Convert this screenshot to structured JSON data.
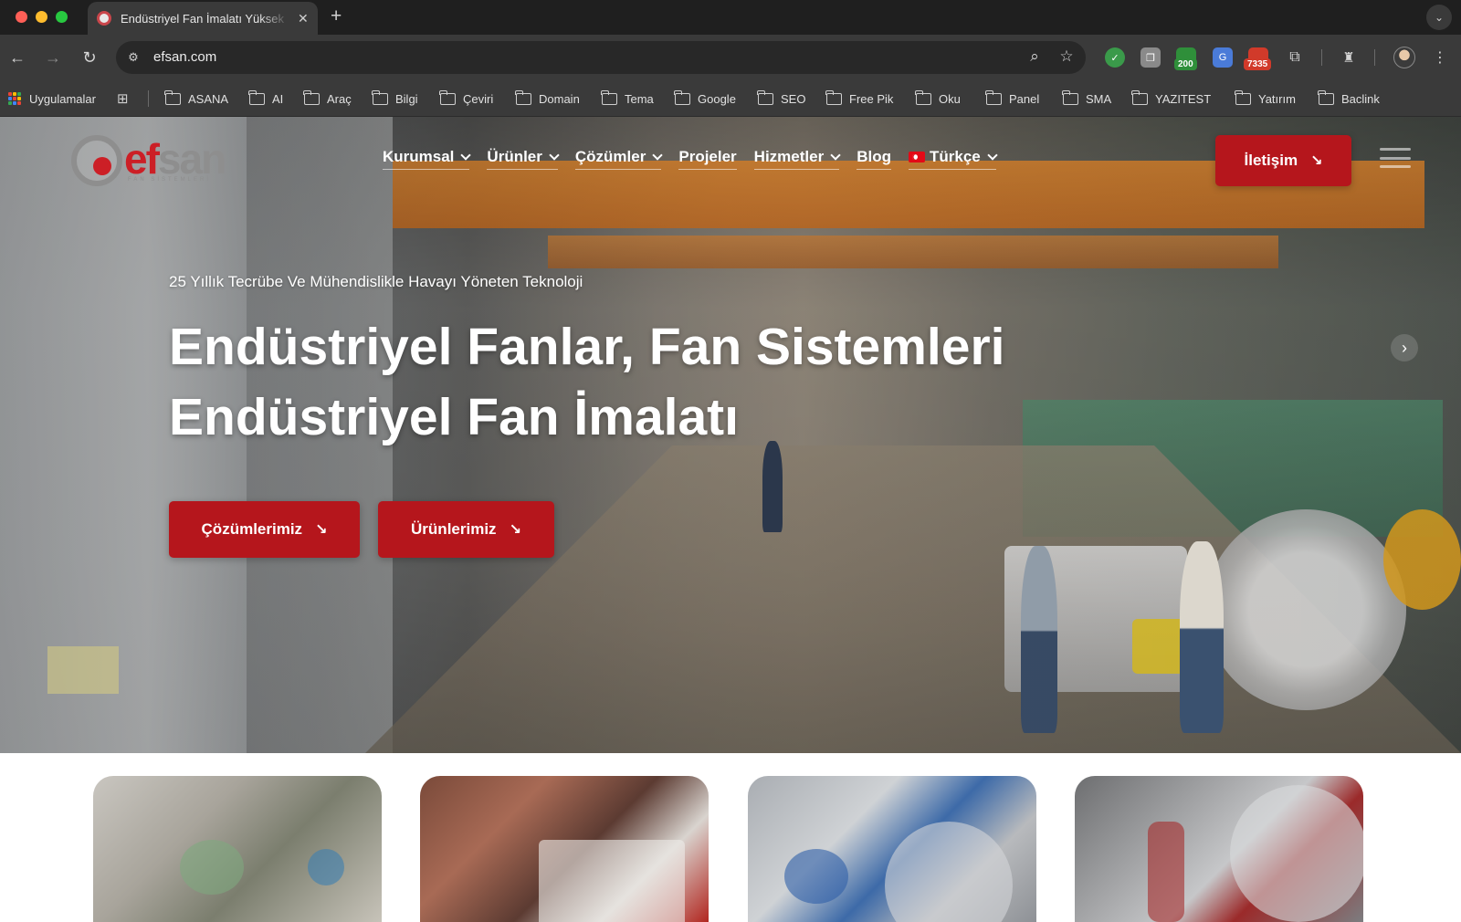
{
  "browser": {
    "tab_title": "Endüstriyel Fan İmalatı Yüksek",
    "url": "efsan.com",
    "extensions": [
      {
        "name": "shield-extension-icon",
        "color": "#3a9a4a"
      },
      {
        "name": "copy-extension-icon",
        "color": "#8a8a8a"
      },
      {
        "name": "badge-200-extension-icon",
        "color": "#2f8f3a",
        "badge": "200"
      },
      {
        "name": "translate-extension-icon",
        "color": "#4a7bd8"
      },
      {
        "name": "badge-7335-extension-icon",
        "color": "#d13a2a",
        "badge": "7335"
      }
    ]
  },
  "bookmarks": {
    "apps_label": "Uygulamalar",
    "folders": [
      "ASANA",
      "AI",
      "Araç",
      "Bilgi",
      "Çeviri",
      "Domain",
      "Tema",
      "Google",
      "SEO",
      "Free Pik",
      "Oku",
      "Panel",
      "SMA",
      "YAZITEST",
      "Yatırım",
      "Baclink"
    ]
  },
  "site": {
    "brand_color": "#b5161c",
    "logo": {
      "part1": "ef",
      "part2": "san",
      "sub": "FAN SİSTEMLERİ"
    },
    "menu": [
      {
        "label": "Kurumsal",
        "dropdown": true
      },
      {
        "label": "Ürünler",
        "dropdown": true
      },
      {
        "label": "Çözümler",
        "dropdown": true
      },
      {
        "label": "Projeler",
        "dropdown": false
      },
      {
        "label": "Hizmetler",
        "dropdown": true
      },
      {
        "label": "Blog",
        "dropdown": false
      },
      {
        "label": "Türkçe",
        "dropdown": true,
        "flag": true
      }
    ],
    "contact_label": "İletişim",
    "hero": {
      "tagline": "25 Yıllık Tecrübe Ve Mühendislikle Havayı Yöneten Teknoloji",
      "headline_line1": "Endüstriyel Fanlar, Fan Sistemleri",
      "headline_line2": "Endüstriyel Fan İmalatı",
      "cta_primary": "Çözümlerimiz",
      "cta_secondary": "Ürünlerimiz"
    }
  }
}
